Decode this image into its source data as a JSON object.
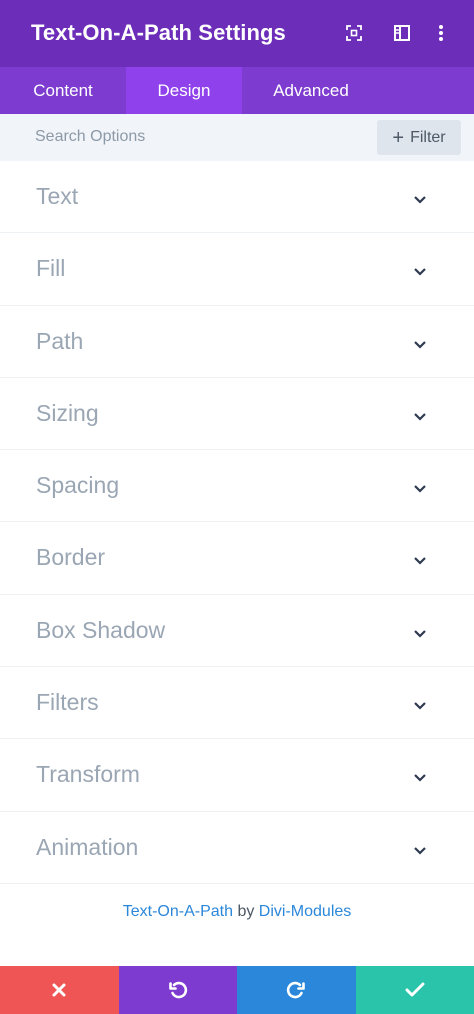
{
  "header": {
    "title": "Text-On-A-Path Settings",
    "icons": [
      "expand-icon",
      "sidebar-layout-icon",
      "more-vertical-icon"
    ],
    "colors": {
      "background": "#6c2eb9"
    }
  },
  "tabs": [
    {
      "label": "Content",
      "active": false
    },
    {
      "label": "Design",
      "active": true
    },
    {
      "label": "Advanced",
      "active": false
    }
  ],
  "search": {
    "placeholder": "Search Options",
    "value": "",
    "filter_label": "Filter"
  },
  "toggles": [
    {
      "label": "Text"
    },
    {
      "label": "Fill"
    },
    {
      "label": "Path"
    },
    {
      "label": "Sizing"
    },
    {
      "label": "Spacing"
    },
    {
      "label": "Border"
    },
    {
      "label": "Box Shadow"
    },
    {
      "label": "Filters"
    },
    {
      "label": "Transform"
    },
    {
      "label": "Animation"
    }
  ],
  "footer": {
    "module_link": "Text-On-A-Path",
    "by": "by",
    "author_link": "Divi-Modules"
  },
  "actions": {
    "cancel_color": "#ef5555",
    "undo_color": "#7e3bd0",
    "redo_color": "#2b87da",
    "save_color": "#29c4a9"
  }
}
